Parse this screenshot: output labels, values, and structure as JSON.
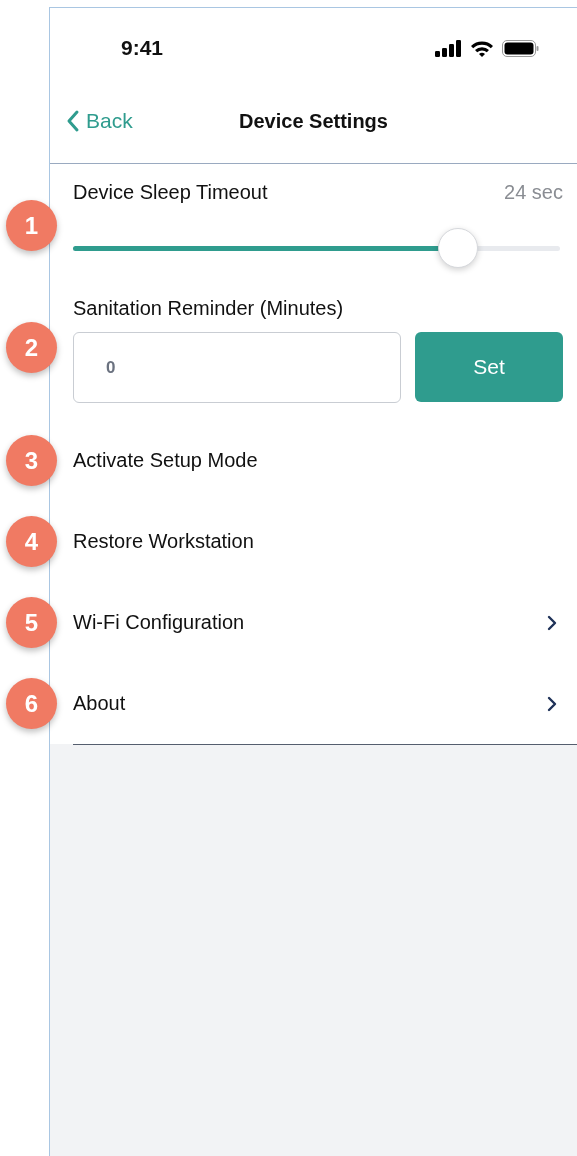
{
  "status_bar": {
    "time": "9:41"
  },
  "nav": {
    "back": "Back",
    "title": "Device Settings"
  },
  "settings": [
    {
      "kind": "slider",
      "marker": "1",
      "label": "Device Sleep Timeout",
      "reading": "24 sec",
      "level": 0.79
    },
    {
      "kind": "input",
      "marker": "2",
      "label": "Sanitation Reminder (Minutes)",
      "value": "0",
      "button": "Set"
    },
    {
      "kind": "action",
      "marker": "3",
      "label": "Activate Setup Mode",
      "chevron": false
    },
    {
      "kind": "action",
      "marker": "4",
      "label": "Restore Workstation",
      "chevron": false
    },
    {
      "kind": "action",
      "marker": "5",
      "label": "Wi-Fi Configuration",
      "chevron": true
    },
    {
      "kind": "action",
      "marker": "6",
      "label": "About",
      "chevron": true
    }
  ]
}
